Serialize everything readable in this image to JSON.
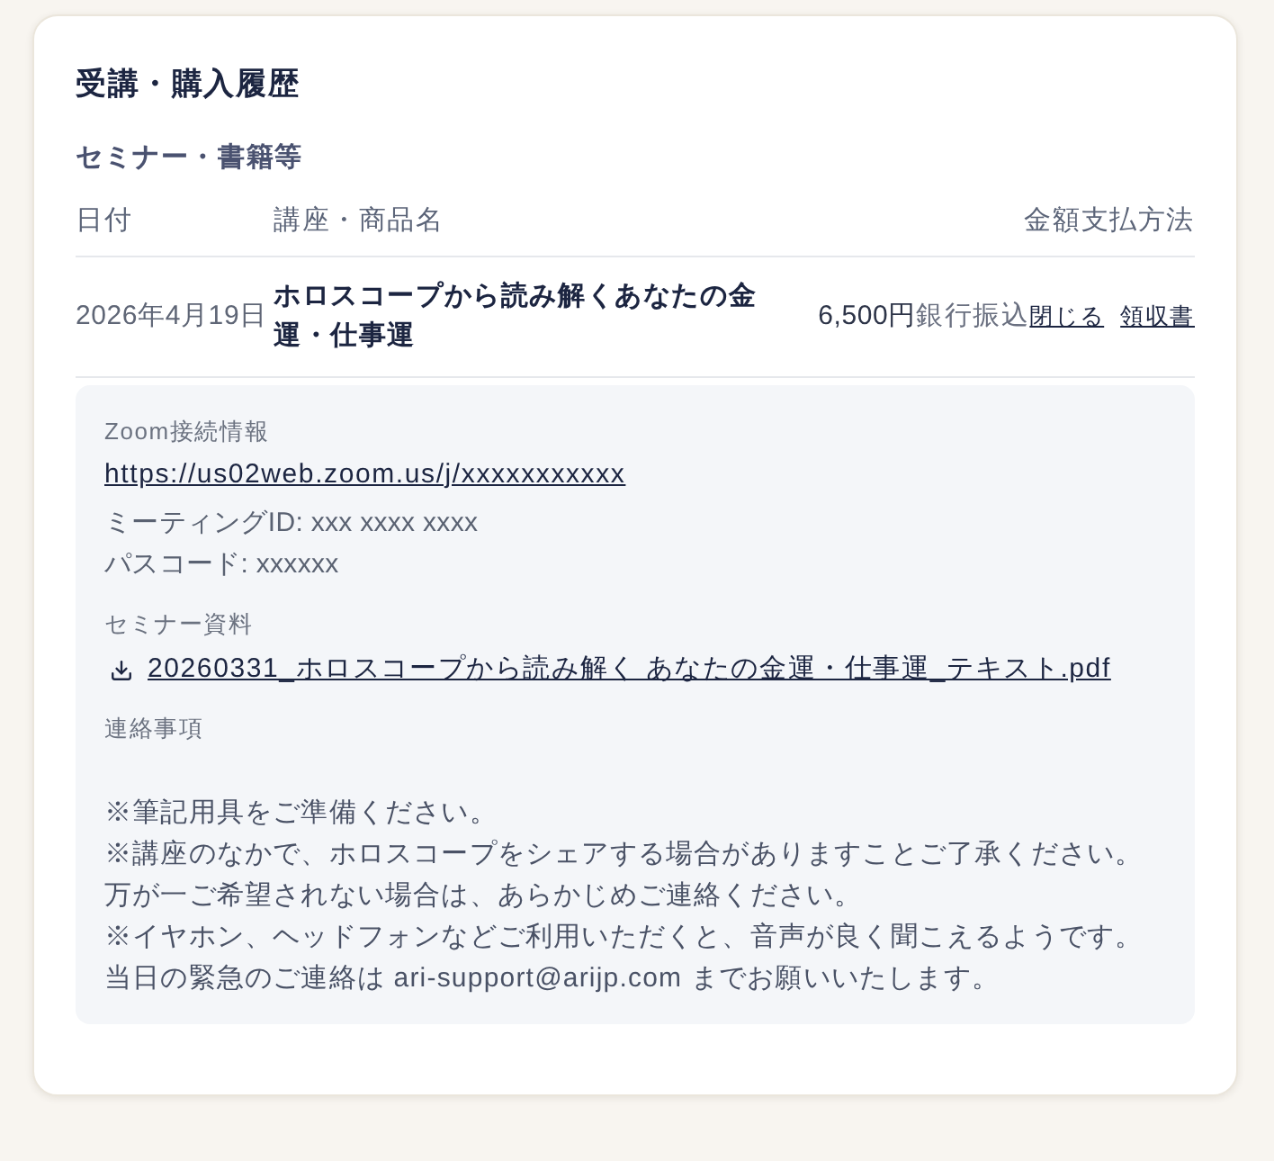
{
  "page": {
    "title": "受講・購入履歴",
    "section_title": "セミナー・書籍等"
  },
  "table": {
    "columns": [
      "日付",
      "講座・商品名",
      "金額",
      "支払方法"
    ],
    "rows": [
      {
        "date": "2026年4月19日",
        "product": "ホロスコープから読み解くあなたの金運・仕事運",
        "amount": "6,500円",
        "payment": "銀行振込",
        "toggle_label": "閉じる",
        "receipt_label": "領収書",
        "expanded": true,
        "details": {
          "zoom_label": "Zoom接続情報",
          "zoom_url": "https://us02web.zoom.us/j/xxxxxxxxxxx",
          "meeting_id": "ミーティングID: xxx xxxx xxxx",
          "passcode": "パスコード: xxxxxx",
          "materials_label": "セミナー資料",
          "materials": [
            "20260331_ホロスコープから読み解く あなたの金運・仕事運_テキスト.pdf"
          ],
          "notes_label": "連絡事項",
          "notes": [
            "※筆記用具をご準備ください。",
            "※講座のなかで、ホロスコープをシェアする場合がありますことご了承ください。",
            "万が一ご希望されない場合は、あらかじめご連絡ください。",
            "※イヤホン、ヘッドフォンなどご利用いただくと、音声が良く聞こえるようです。",
            "当日の緊急のご連絡は ari-support@arijp.com までお願いいたします。"
          ]
        }
      }
    ]
  }
}
